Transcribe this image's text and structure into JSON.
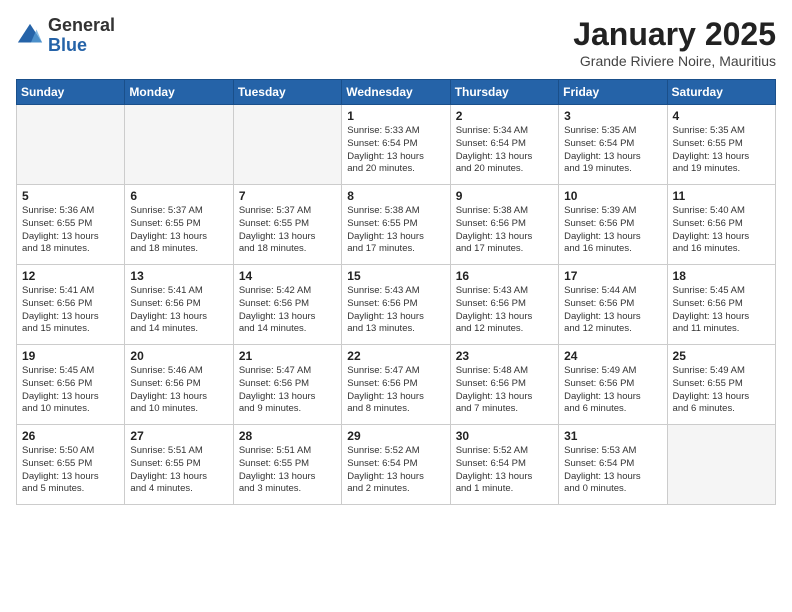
{
  "header": {
    "logo_general": "General",
    "logo_blue": "Blue",
    "month_title": "January 2025",
    "subtitle": "Grande Riviere Noire, Mauritius"
  },
  "days_of_week": [
    "Sunday",
    "Monday",
    "Tuesday",
    "Wednesday",
    "Thursday",
    "Friday",
    "Saturday"
  ],
  "weeks": [
    [
      {
        "day": "",
        "content": ""
      },
      {
        "day": "",
        "content": ""
      },
      {
        "day": "",
        "content": ""
      },
      {
        "day": "1",
        "content": "Sunrise: 5:33 AM\nSunset: 6:54 PM\nDaylight: 13 hours\nand 20 minutes."
      },
      {
        "day": "2",
        "content": "Sunrise: 5:34 AM\nSunset: 6:54 PM\nDaylight: 13 hours\nand 20 minutes."
      },
      {
        "day": "3",
        "content": "Sunrise: 5:35 AM\nSunset: 6:54 PM\nDaylight: 13 hours\nand 19 minutes."
      },
      {
        "day": "4",
        "content": "Sunrise: 5:35 AM\nSunset: 6:55 PM\nDaylight: 13 hours\nand 19 minutes."
      }
    ],
    [
      {
        "day": "5",
        "content": "Sunrise: 5:36 AM\nSunset: 6:55 PM\nDaylight: 13 hours\nand 18 minutes."
      },
      {
        "day": "6",
        "content": "Sunrise: 5:37 AM\nSunset: 6:55 PM\nDaylight: 13 hours\nand 18 minutes."
      },
      {
        "day": "7",
        "content": "Sunrise: 5:37 AM\nSunset: 6:55 PM\nDaylight: 13 hours\nand 18 minutes."
      },
      {
        "day": "8",
        "content": "Sunrise: 5:38 AM\nSunset: 6:55 PM\nDaylight: 13 hours\nand 17 minutes."
      },
      {
        "day": "9",
        "content": "Sunrise: 5:38 AM\nSunset: 6:56 PM\nDaylight: 13 hours\nand 17 minutes."
      },
      {
        "day": "10",
        "content": "Sunrise: 5:39 AM\nSunset: 6:56 PM\nDaylight: 13 hours\nand 16 minutes."
      },
      {
        "day": "11",
        "content": "Sunrise: 5:40 AM\nSunset: 6:56 PM\nDaylight: 13 hours\nand 16 minutes."
      }
    ],
    [
      {
        "day": "12",
        "content": "Sunrise: 5:41 AM\nSunset: 6:56 PM\nDaylight: 13 hours\nand 15 minutes."
      },
      {
        "day": "13",
        "content": "Sunrise: 5:41 AM\nSunset: 6:56 PM\nDaylight: 13 hours\nand 14 minutes."
      },
      {
        "day": "14",
        "content": "Sunrise: 5:42 AM\nSunset: 6:56 PM\nDaylight: 13 hours\nand 14 minutes."
      },
      {
        "day": "15",
        "content": "Sunrise: 5:43 AM\nSunset: 6:56 PM\nDaylight: 13 hours\nand 13 minutes."
      },
      {
        "day": "16",
        "content": "Sunrise: 5:43 AM\nSunset: 6:56 PM\nDaylight: 13 hours\nand 12 minutes."
      },
      {
        "day": "17",
        "content": "Sunrise: 5:44 AM\nSunset: 6:56 PM\nDaylight: 13 hours\nand 12 minutes."
      },
      {
        "day": "18",
        "content": "Sunrise: 5:45 AM\nSunset: 6:56 PM\nDaylight: 13 hours\nand 11 minutes."
      }
    ],
    [
      {
        "day": "19",
        "content": "Sunrise: 5:45 AM\nSunset: 6:56 PM\nDaylight: 13 hours\nand 10 minutes."
      },
      {
        "day": "20",
        "content": "Sunrise: 5:46 AM\nSunset: 6:56 PM\nDaylight: 13 hours\nand 10 minutes."
      },
      {
        "day": "21",
        "content": "Sunrise: 5:47 AM\nSunset: 6:56 PM\nDaylight: 13 hours\nand 9 minutes."
      },
      {
        "day": "22",
        "content": "Sunrise: 5:47 AM\nSunset: 6:56 PM\nDaylight: 13 hours\nand 8 minutes."
      },
      {
        "day": "23",
        "content": "Sunrise: 5:48 AM\nSunset: 6:56 PM\nDaylight: 13 hours\nand 7 minutes."
      },
      {
        "day": "24",
        "content": "Sunrise: 5:49 AM\nSunset: 6:56 PM\nDaylight: 13 hours\nand 6 minutes."
      },
      {
        "day": "25",
        "content": "Sunrise: 5:49 AM\nSunset: 6:55 PM\nDaylight: 13 hours\nand 6 minutes."
      }
    ],
    [
      {
        "day": "26",
        "content": "Sunrise: 5:50 AM\nSunset: 6:55 PM\nDaylight: 13 hours\nand 5 minutes."
      },
      {
        "day": "27",
        "content": "Sunrise: 5:51 AM\nSunset: 6:55 PM\nDaylight: 13 hours\nand 4 minutes."
      },
      {
        "day": "28",
        "content": "Sunrise: 5:51 AM\nSunset: 6:55 PM\nDaylight: 13 hours\nand 3 minutes."
      },
      {
        "day": "29",
        "content": "Sunrise: 5:52 AM\nSunset: 6:54 PM\nDaylight: 13 hours\nand 2 minutes."
      },
      {
        "day": "30",
        "content": "Sunrise: 5:52 AM\nSunset: 6:54 PM\nDaylight: 13 hours\nand 1 minute."
      },
      {
        "day": "31",
        "content": "Sunrise: 5:53 AM\nSunset: 6:54 PM\nDaylight: 13 hours\nand 0 minutes."
      },
      {
        "day": "",
        "content": ""
      }
    ]
  ]
}
